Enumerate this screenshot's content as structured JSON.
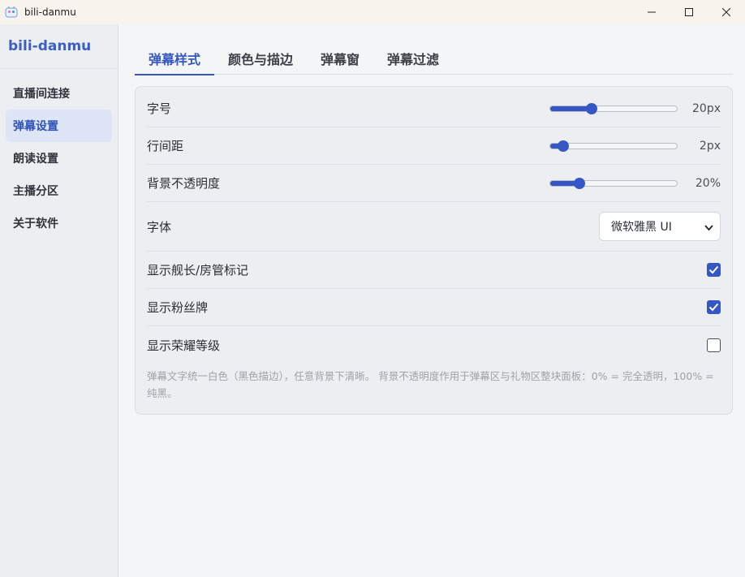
{
  "window": {
    "title": "bili-danmu"
  },
  "sidebar": {
    "brand": "bili-danmu",
    "items": [
      {
        "label": "直播间连接",
        "active": false
      },
      {
        "label": "弹幕设置",
        "active": true
      },
      {
        "label": "朗读设置",
        "active": false
      },
      {
        "label": "主播分区",
        "active": false
      },
      {
        "label": "关于软件",
        "active": false
      }
    ]
  },
  "tabs": [
    {
      "label": "弹幕样式",
      "active": true
    },
    {
      "label": "颜色与描边",
      "active": false
    },
    {
      "label": "弹幕窗",
      "active": false
    },
    {
      "label": "弹幕过滤",
      "active": false
    }
  ],
  "settings": {
    "font_size": {
      "label": "字号",
      "value_text": "20px",
      "fraction": 0.33
    },
    "line_spacing": {
      "label": "行间距",
      "value_text": "2px",
      "fraction": 0.1
    },
    "bg_opacity": {
      "label": "背景不透明度",
      "value_text": "20%",
      "fraction": 0.23
    },
    "font": {
      "label": "字体",
      "selected": "微软雅黑 UI"
    },
    "show_guard": {
      "label": "显示舰长/房管标记",
      "checked": true
    },
    "show_medal": {
      "label": "显示粉丝牌",
      "checked": true
    },
    "show_honor": {
      "label": "显示荣耀等级",
      "checked": false
    },
    "hint": "弹幕文字统一白色（黑色描边），任意背景下清晰。 背景不透明度作用于弹幕区与礼物区整块面板：0% = 完全透明，100% = 纯黑。"
  },
  "colors": {
    "accent": "#3557c6",
    "brand": "#3a5fc8"
  },
  "icons": {
    "app": "bili-danmu-app-icon",
    "minimize": "minimize-icon",
    "maximize": "maximize-icon",
    "close": "close-icon",
    "select": "chevron-down-icon",
    "check": "checkmark-icon"
  }
}
